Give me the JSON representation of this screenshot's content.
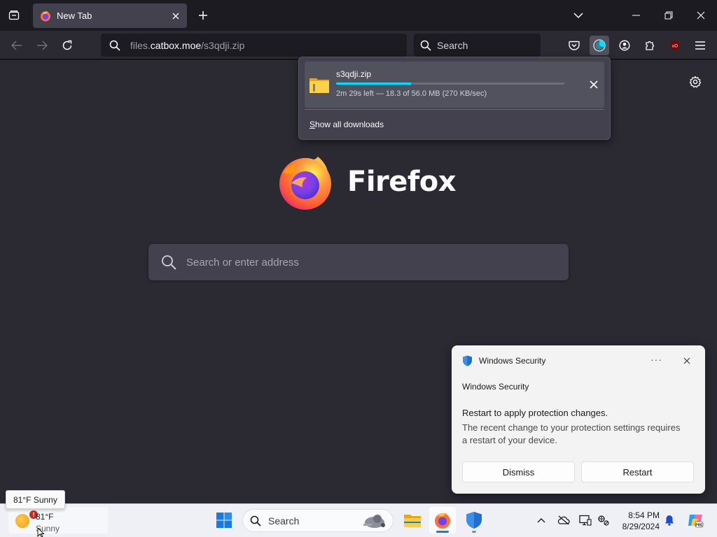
{
  "browser": {
    "tab": {
      "title": "New Tab"
    },
    "url": {
      "host": "files.",
      "domain": "catbox.moe",
      "path": "/s3qdji.zip"
    },
    "search_placeholder": "Search"
  },
  "downloads": {
    "file_name": "s3qdji.zip",
    "progress": 0.327,
    "status": "2m 29s left — 18.3 of 56.0 MB (270 KB/sec)",
    "show_all_label_first": "S",
    "show_all_label_rest": "how all downloads"
  },
  "newtab": {
    "brand": "Firefox",
    "search_placeholder": "Search or enter address"
  },
  "toast": {
    "app_name": "Windows Security",
    "more": "···",
    "source": "Windows Security",
    "title": "Restart to apply protection changes.",
    "body": "The recent change to your protection settings requires a restart of your device.",
    "dismiss_label": "Dismiss",
    "restart_label": "Restart"
  },
  "taskbar": {
    "weather_tooltip": "81°F Sunny",
    "weather_temp": "81°F",
    "weather_cond": "Sunny",
    "weather_badge": "!",
    "search_placeholder": "Search",
    "time": "8:54 PM",
    "date": "8/29/2024"
  },
  "colors": {
    "accent": "#00ddff",
    "toolbar": "#2b2a33",
    "content": "#2b2a33",
    "panel": "#42414d",
    "taskbar": "#eef0f5"
  }
}
